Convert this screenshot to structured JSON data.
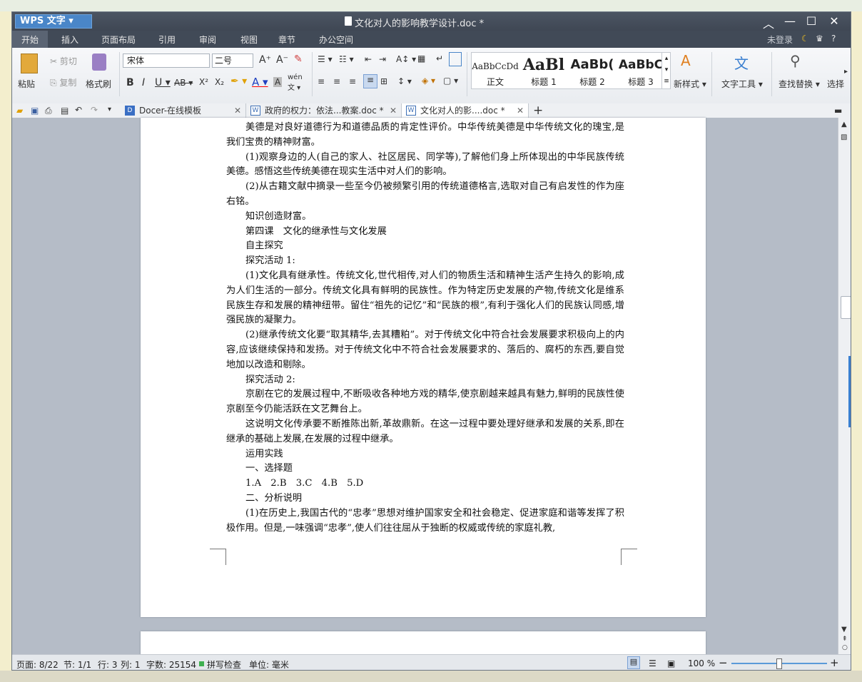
{
  "app": {
    "name": "WPS 文字",
    "doc_title": "文化对人的影响教学设计.doc *"
  },
  "menu": [
    "开始",
    "插入",
    "页面布局",
    "引用",
    "审阅",
    "视图",
    "章节",
    "办公空间"
  ],
  "account": {
    "login": "未登录",
    "help": "?"
  },
  "ribbon": {
    "paste": "粘贴",
    "cut": "剪切",
    "copy": "复制",
    "format_painter": "格式刷",
    "font": "宋体",
    "font_size": "二号",
    "styles": [
      {
        "sample": "AaBbCcDd",
        "label": "正文"
      },
      {
        "sample": "AaBl",
        "label": "标题 1"
      },
      {
        "sample": "AaBb(",
        "label": "标题 2"
      },
      {
        "sample": "AaBbC",
        "label": "标题 3"
      }
    ],
    "new_style": "新样式",
    "text_tools": "文字工具",
    "find_replace": "查找替换",
    "select": "选择"
  },
  "tabs": [
    {
      "label": "Docer-在线模板",
      "active": false
    },
    {
      "label": "政府的权力：依法...教案.doc *",
      "active": false
    },
    {
      "label": "文化对人的影....doc *",
      "active": true
    }
  ],
  "document": {
    "paragraphs": [
      {
        "text": "美德是对良好道德行为和道德品质的肯定性评价。中华传统美德是中华传统文化的瑰宝,是我们宝贵的精神财富。",
        "indent": true
      },
      {
        "text": "(1)观察身边的人(自己的家人、社区居民、同学等),了解他们身上所体现出的中华民族传统美德。感悟这些传统美德在现实生活中对人们的影响。",
        "indent": true
      },
      {
        "text": "(2)从古籍文献中摘录一些至今仍被频繁引用的传统道德格言,选取对自己有启发性的作为座右铭。",
        "indent": true
      },
      {
        "text": "知识创造财富。",
        "indent": true
      },
      {
        "text": "第四课　文化的继承性与文化发展",
        "indent": true
      },
      {
        "text": "自主探究",
        "indent": true
      },
      {
        "text": "探究活动 1:",
        "indent": true
      },
      {
        "text": "(1)文化具有继承性。传统文化,世代相传,对人们的物质生活和精神生活产生持久的影响,成为人们生活的一部分。传统文化具有鲜明的民族性。作为特定历史发展的产物,传统文化是维系民族生存和发展的精神纽带。留住“祖先的记忆”和“民族的根”,有利于强化人们的民族认同感,增强民族的凝聚力。",
        "indent": true
      },
      {
        "text": "(2)继承传统文化要“取其精华,去其糟粕”。对于传统文化中符合社会发展要求积极向上的内容,应该继续保持和发扬。对于传统文化中不符合社会发展要求的、落后的、腐朽的东西,要自觉地加以改造和剔除。",
        "indent": true
      },
      {
        "text": "探究活动 2:",
        "indent": true
      },
      {
        "text": "京剧在它的发展过程中,不断吸收各种地方戏的精华,使京剧越来越具有魅力,鲜明的民族性使京剧至今仍能活跃在文艺舞台上。",
        "indent": true
      },
      {
        "text": "这说明文化传承要不断推陈出新,革故鼎新。在这一过程中要处理好继承和发展的关系,即在继承的基础上发展,在发展的过程中继承。",
        "indent": true
      },
      {
        "text": "运用实践",
        "indent": true
      },
      {
        "text": "一、选择题",
        "indent": true
      },
      {
        "text": "1.A　2.B　3.C　4.B　5.D",
        "indent": true
      },
      {
        "text": "二、分析说明",
        "indent": true
      },
      {
        "text": "(1)在历史上,我国古代的“忠孝”思想对维护国家安全和社会稳定、促进家庭和谐等发挥了积极作用。但是,一味强调“忠孝”,使人们往往屈从于独断的权威或传统的家庭礼教,",
        "indent": true
      }
    ]
  },
  "status": {
    "page": "页面: 8/22",
    "section": "节: 1/1",
    "row": "行: 3",
    "col": "列: 1",
    "words": "字数: 25154",
    "spell": "拼写检查",
    "unit": "单位: 毫米",
    "zoom": "100 %"
  },
  "colors": {
    "accent": "#3a7fd0",
    "titlebar": "#414a57"
  }
}
